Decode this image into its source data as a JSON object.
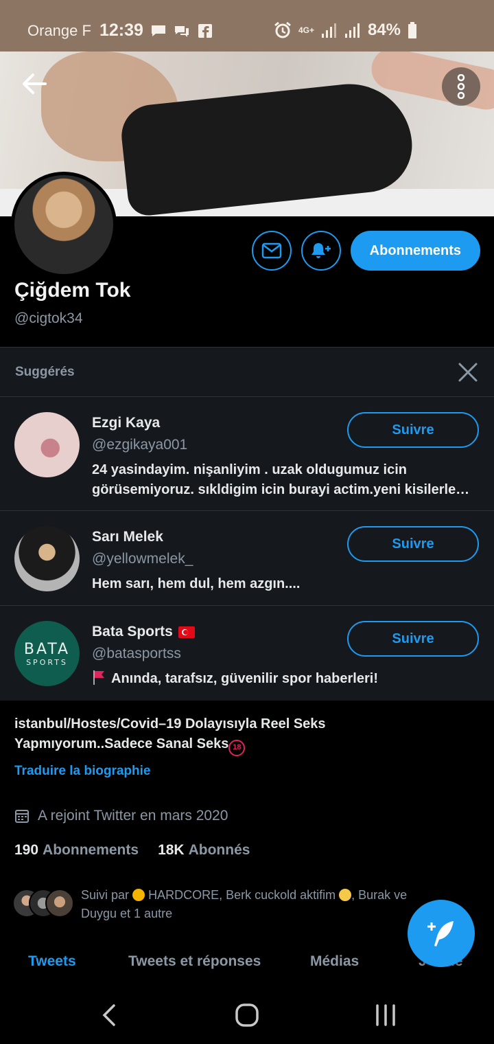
{
  "status_bar": {
    "carrier": "Orange F",
    "time": "12:39",
    "network": "4G+",
    "battery": "84%"
  },
  "profile": {
    "display_name": "Çiğdem Tok",
    "handle": "@cigtok34",
    "subscribe_label": "Abonnements",
    "bio_line1": "istanbul/Hostes/Covid–19 Dolayısıyla Reel Seks",
    "bio_line2": "Yapmıyorum..Sadece Sanal Seks",
    "bio_badge": "18",
    "translate_label": "Traduire la biographie",
    "joined": "A rejoint Twitter en mars 2020",
    "following_count": "190",
    "following_label": "Abonnements",
    "followers_count": "18K",
    "followers_label": "Abonnés",
    "followed_by_prefix": "Suivi par",
    "followed_by_names": "HARDCORE, Berk cuckold aktifim",
    "followed_by_rest": ", Burak ve",
    "followed_by_line2": "Duygu et 1 autre"
  },
  "suggestions": {
    "title": "Suggérés",
    "follow_label": "Suivre",
    "items": [
      {
        "name": "Ezgi Kaya",
        "handle": "@ezgikaya001",
        "bio_line1": "24 yasindayim. nişanliyim . uzak oldugumuz icin",
        "bio_line2": "görüsemiyoruz. sıkldigim icin burayi actim.yeni kisilerle…"
      },
      {
        "name": "Sarı Melek",
        "handle": "@yellowmelek_",
        "bio_line1": "Hem sarı, hem dul, hem azgın...."
      },
      {
        "name": "Bata Sports",
        "handle": "@batasportss",
        "bio_line1": "Anında, tarafsız, güvenilir spor haberleri!",
        "logo_top": "BATA",
        "logo_bottom": "SPORTS"
      }
    ]
  },
  "tabs": [
    "Tweets",
    "Tweets et réponses",
    "Médias",
    "J'aime"
  ],
  "colors": {
    "accent": "#1d9bf0",
    "background": "#000000",
    "card": "#15181c",
    "muted_text": "#8b98a5",
    "status_bar": "#8c7562"
  },
  "icons": [
    "back-arrow-icon",
    "more-vertical-icon",
    "mail-icon",
    "bell-plus-icon",
    "close-icon",
    "calendar-icon",
    "compose-tweet-icon",
    "nav-back-icon",
    "nav-home-icon",
    "nav-recents-icon"
  ]
}
